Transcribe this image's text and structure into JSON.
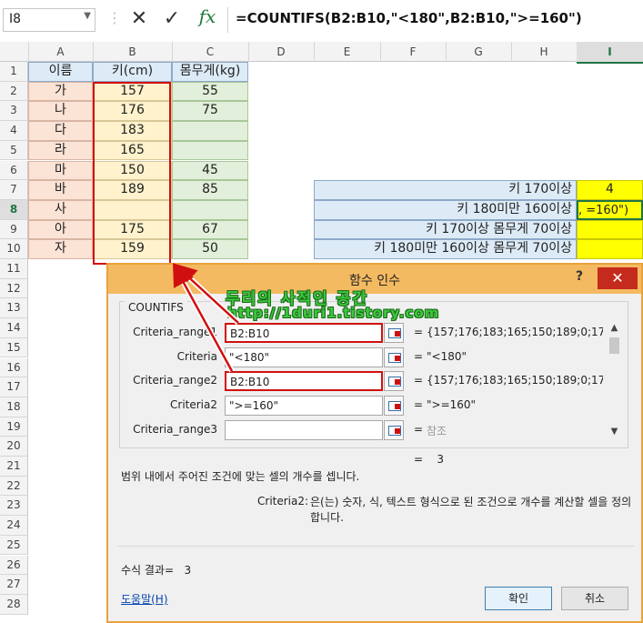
{
  "formula_bar": {
    "name_box": "I8",
    "cancel_icon": "✕",
    "enter_icon": "✓",
    "fx_label": "fx",
    "formula": "=COUNTIFS(B2:B10,\"<180\",B2:B10,\">=160\")"
  },
  "columns": [
    "A",
    "B",
    "C",
    "D",
    "E",
    "F",
    "G",
    "H",
    "I"
  ],
  "rows": [
    "1",
    "2",
    "3",
    "4",
    "5",
    "6",
    "7",
    "8",
    "9",
    "10",
    "11",
    "12",
    "13",
    "14",
    "15",
    "16",
    "17",
    "18",
    "19",
    "20",
    "21",
    "22",
    "23",
    "24",
    "25",
    "26",
    "27",
    "28"
  ],
  "selected_column": "I",
  "selected_row": "8",
  "sheet": {
    "headers": {
      "name": "이름",
      "height": "키(cm)",
      "weight": "몸무게(kg)"
    },
    "names": [
      "가",
      "나",
      "다",
      "라",
      "마",
      "바",
      "사",
      "아",
      "자"
    ],
    "heights": [
      "157",
      "176",
      "183",
      "165",
      "150",
      "189",
      "",
      "175",
      "159"
    ],
    "weights": [
      "55",
      "75",
      "",
      "",
      "45",
      "85",
      "",
      "67",
      "50"
    ],
    "criteria_labels": [
      "키 170이상",
      "키 180미만 160이상",
      "키 170이상 몸무게 70이상",
      "키 180미만 160이상 몸무게 70이상"
    ],
    "criteria_results": [
      "4",
      ", =160\")",
      "",
      ""
    ]
  },
  "dialog": {
    "title": "함수 인수",
    "help_icon": "?",
    "close_icon": "✕",
    "function_name": "COUNTIFS",
    "args": [
      {
        "label": "Criteria_range1",
        "value": "B2:B10",
        "result": "{157;176;183;165;150;189;0;17..."
      },
      {
        "label": "Criteria",
        "value": "\"<180\"",
        "result": "\"<180\""
      },
      {
        "label": "Criteria_range2",
        "value": "B2:B10",
        "result": "{157;176;183;165;150;189;0;175;1"
      },
      {
        "label": "Criteria2",
        "value": "\">=160\"",
        "result": "\">=160\""
      },
      {
        "label": "Criteria_range3",
        "value": "",
        "result": "참조"
      }
    ],
    "eq": "=",
    "function_result": "3",
    "description": "범위 내에서 주어진 조건에 맞는 셀의 개수를 셉니다.",
    "arg_desc_name": "Criteria2:",
    "arg_desc_text": "은(는) 숫자, 식, 텍스트 형식으로 된 조건으로 개수를 계산할 셀을 정의합니다.",
    "formula_result_label": "수식 결과=",
    "formula_result": "3",
    "help_link": "도움말(H)",
    "ok": "확인",
    "cancel": "취소"
  },
  "watermark": {
    "title": "두리의 사적인 공간",
    "url": "http://1duri1.tistory.com"
  },
  "colors": {
    "header_fill": "#ddebf7",
    "name_fill": "#fbe3d6",
    "height_fill": "#fff2cc",
    "weight_fill": "#e2efda",
    "result_fill": "#ffff00",
    "dialog_title": "#f4ba62",
    "highlight": "#d01010",
    "excel_green": "#217346"
  }
}
